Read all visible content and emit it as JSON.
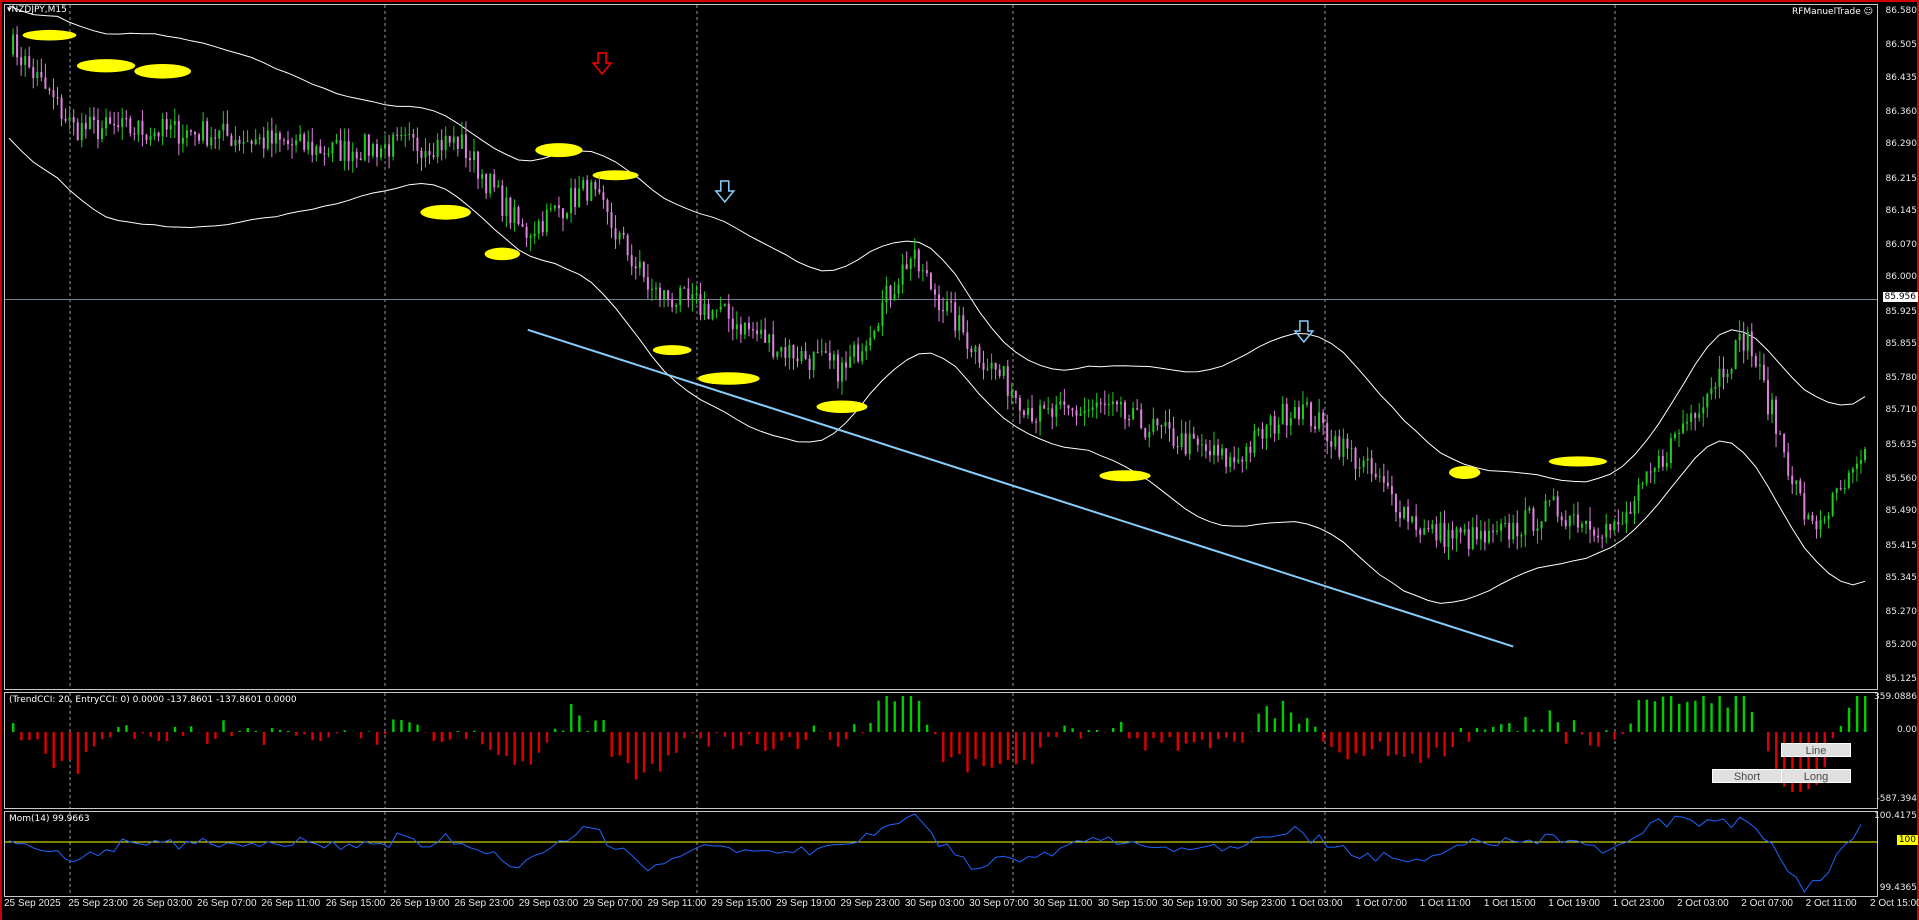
{
  "symbol": "NZDJPY,M15",
  "ea_name": "RFManuelTrade",
  "current_price": "85.956",
  "price_axis": [
    "86.580",
    "86.505",
    "86.435",
    "86.360",
    "86.290",
    "86.215",
    "86.145",
    "86.070",
    "86.000",
    "85.925",
    "85.855",
    "85.780",
    "85.710",
    "85.635",
    "85.560",
    "85.490",
    "85.415",
    "85.345",
    "85.270",
    "85.200",
    "85.125"
  ],
  "cci": {
    "label": "(TrendCCI: 20, EntryCCI: 0)  0.0000 -137.8601 -137.8601 0.0000",
    "axis": [
      "359.0886",
      "0.00",
      "-587.394"
    ]
  },
  "mom": {
    "label": "Mom(14) 99.9663",
    "axis": [
      "100.4175",
      "100",
      "99.4365"
    ]
  },
  "buttons": {
    "line": "Line",
    "short": "Short",
    "long": "Long"
  },
  "time_axis": [
    "25 Sep 2025",
    "25 Sep 23:00",
    "26 Sep 03:00",
    "26 Sep 07:00",
    "26 Sep 11:00",
    "26 Sep 15:00",
    "26 Sep 19:00",
    "26 Sep 23:00",
    "29 Sep 03:00",
    "29 Sep 07:00",
    "29 Sep 11:00",
    "29 Sep 15:00",
    "29 Sep 19:00",
    "29 Sep 23:00",
    "30 Sep 03:00",
    "30 Sep 07:00",
    "30 Sep 11:00",
    "30 Sep 15:00",
    "30 Sep 19:00",
    "30 Sep 23:00",
    "1 Oct 03:00",
    "1 Oct 07:00",
    "1 Oct 11:00",
    "1 Oct 15:00",
    "1 Oct 19:00",
    "1 Oct 23:00",
    "2 Oct 03:00",
    "2 Oct 07:00",
    "2 Oct 11:00",
    "2 Oct 15:00"
  ],
  "colors": {
    "bull": "#22cc22",
    "bear": "#e080e0",
    "envelope": "#ffff00",
    "band": "#ffffff",
    "trendline": "#87cefa",
    "arrow_red": "#ff0000",
    "arrow_blue": "#87cefa",
    "cci_pos": "#00cc00",
    "cci_neg": "#dd0000",
    "mom": "#1e64ff",
    "mom_level": "#ffff00"
  },
  "chart_data": {
    "type": "candlestick",
    "symbol": "NZDJPY",
    "timeframe": "M15",
    "ylim": [
      85.125,
      86.58
    ],
    "close_anchors": [
      {
        "t": "25 Sep 2025",
        "v": 86.52
      },
      {
        "t": "25 Sep 23:00",
        "v": 86.33
      },
      {
        "t": "26 Sep 07:00",
        "v": 86.32
      },
      {
        "t": "26 Sep 15:00",
        "v": 86.28
      },
      {
        "t": "26 Sep 23:00",
        "v": 86.3
      },
      {
        "t": "29 Sep 03:00",
        "v": 86.1
      },
      {
        "t": "29 Sep 07:00",
        "v": 86.2
      },
      {
        "t": "29 Sep 11:00",
        "v": 85.97
      },
      {
        "t": "29 Sep 15:00",
        "v": 85.93
      },
      {
        "t": "29 Sep 19:00",
        "v": 85.85
      },
      {
        "t": "29 Sep 23:00",
        "v": 85.8
      },
      {
        "t": "30 Sep 03:00",
        "v": 86.05
      },
      {
        "t": "30 Sep 07:00",
        "v": 85.85
      },
      {
        "t": "30 Sep 11:00",
        "v": 85.7
      },
      {
        "t": "30 Sep 15:00",
        "v": 85.72
      },
      {
        "t": "30 Sep 19:00",
        "v": 85.66
      },
      {
        "t": "30 Sep 23:00",
        "v": 85.6
      },
      {
        "t": "1 Oct 03:00",
        "v": 85.73
      },
      {
        "t": "1 Oct 07:00",
        "v": 85.6
      },
      {
        "t": "1 Oct 11:00",
        "v": 85.45
      },
      {
        "t": "1 Oct 15:00",
        "v": 85.43
      },
      {
        "t": "1 Oct 19:00",
        "v": 85.5
      },
      {
        "t": "1 Oct 23:00",
        "v": 85.45
      },
      {
        "t": "2 Oct 03:00",
        "v": 85.68
      },
      {
        "t": "2 Oct 07:00",
        "v": 85.88
      },
      {
        "t": "2 Oct 11:00",
        "v": 85.45
      },
      {
        "t": "2 Oct 15:00",
        "v": 85.63
      }
    ],
    "trendline": [
      {
        "t": "29 Sep 03:00",
        "v": 85.89
      },
      {
        "t": "1 Oct 19:00",
        "v": 85.2
      }
    ],
    "signals": [
      {
        "t": "29 Sep 07:00",
        "dir": "down",
        "color": "red"
      },
      {
        "t": "29 Sep 15:00",
        "dir": "down",
        "color": "blue"
      },
      {
        "t": "1 Oct 03:00",
        "dir": "down",
        "color": "blue"
      }
    ]
  }
}
